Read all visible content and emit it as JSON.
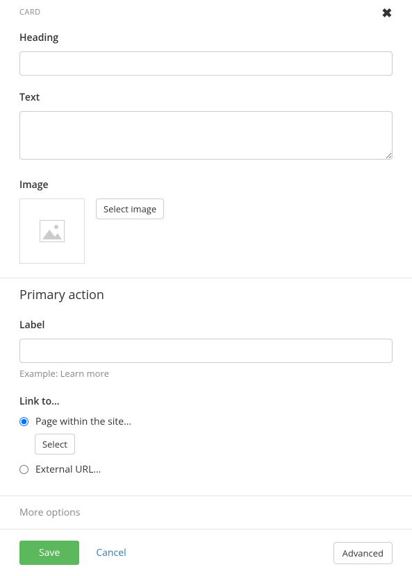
{
  "header": {
    "title": "CARD"
  },
  "fields": {
    "heading": {
      "label": "Heading",
      "value": ""
    },
    "text": {
      "label": "Text",
      "value": ""
    },
    "image": {
      "label": "Image",
      "select_button": "Select image"
    }
  },
  "primary_action": {
    "title": "Primary action",
    "label_field": {
      "label": "Label",
      "value": "",
      "help": "Example: Learn more"
    },
    "link_to": {
      "label": "Link to…",
      "options": {
        "internal": {
          "label": "Page within the site…",
          "select_button": "Select",
          "checked": true
        },
        "external": {
          "label": "External URL…",
          "checked": false
        }
      }
    }
  },
  "more_options": {
    "label": "More options"
  },
  "footer": {
    "save": "Save",
    "cancel": "Cancel",
    "advanced": "Advanced"
  }
}
